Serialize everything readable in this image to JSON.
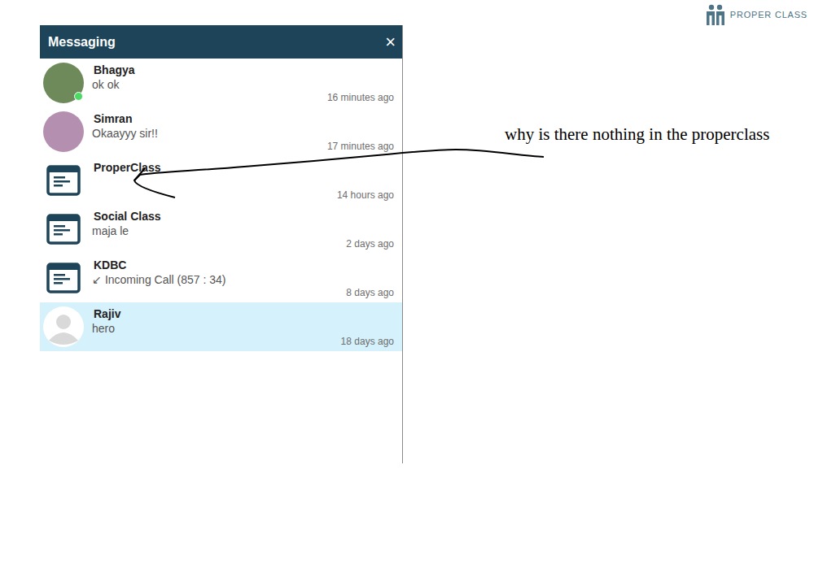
{
  "logo": {
    "text": "PROPER CLASS"
  },
  "panel": {
    "title": "Messaging",
    "close": "×"
  },
  "conversations": [
    {
      "name": "Bhagya",
      "preview": "ok ok",
      "time": "16 minutes ago",
      "kind": "photo",
      "color": "#6f8a5a",
      "online": true,
      "selected": false
    },
    {
      "name": "Simran",
      "preview": "Okaayyy sir!!",
      "time": "17 minutes ago",
      "kind": "photo",
      "color": "#b48fb0",
      "online": false,
      "selected": false
    },
    {
      "name": "ProperClass",
      "preview": "",
      "time": "14 hours ago",
      "kind": "group",
      "color": "#1d4459",
      "online": false,
      "selected": false
    },
    {
      "name": "Social Class",
      "preview": "maja le",
      "time": "2 days ago",
      "kind": "group",
      "color": "#1d4459",
      "online": false,
      "selected": false
    },
    {
      "name": "KDBC",
      "preview": "↙ Incoming Call (857 : 34)",
      "time": "8 days ago",
      "kind": "group",
      "color": "#1d4459",
      "online": false,
      "selected": false
    },
    {
      "name": "Rajiv",
      "preview": "hero",
      "time": "18 days ago",
      "kind": "default",
      "color": "#d9d9d9",
      "online": false,
      "selected": true
    }
  ],
  "annotation": {
    "text": "why is there nothing in the properclass"
  }
}
